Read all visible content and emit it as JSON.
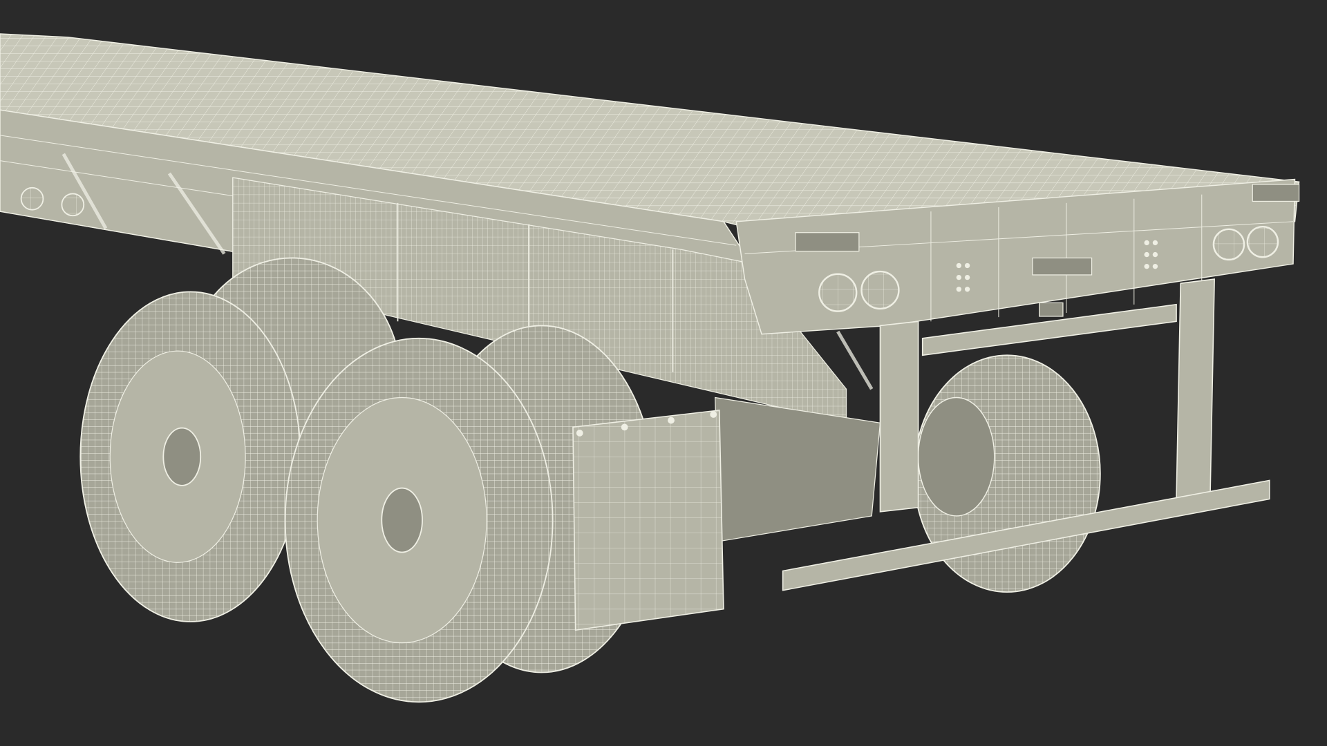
{
  "scene": {
    "subject": "flatbed-trailer-wireframe",
    "colors": {
      "background": "#2a2a2a",
      "surface": "#b5b5a6",
      "surface_light": "#c7c7b8",
      "surface_dark": "#8f8f82",
      "wire": "#efefe4",
      "tire": "#a6a698",
      "shadow": "#5a5a52"
    }
  }
}
